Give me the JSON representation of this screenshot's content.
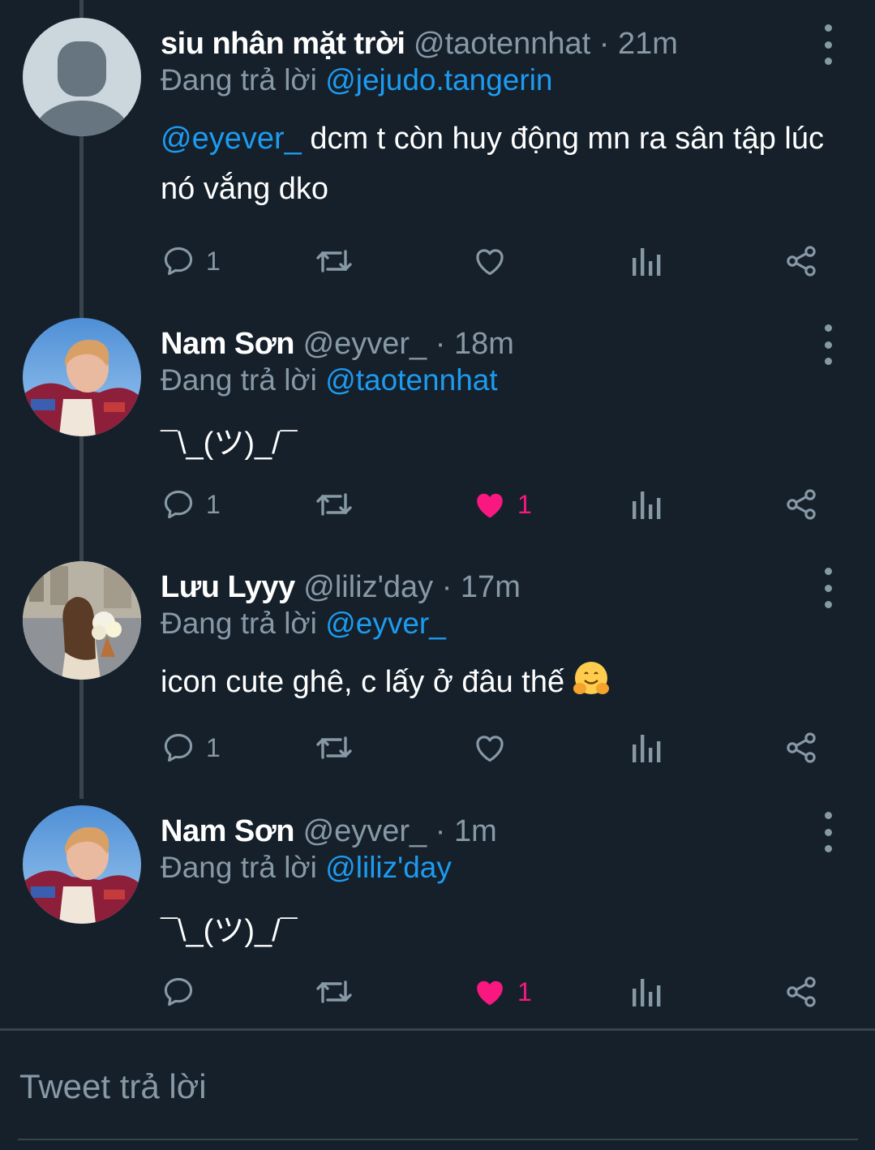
{
  "colors": {
    "background": "#15202b",
    "mention": "#1d9bf0",
    "muted": "#8899a6",
    "like": "#f91880",
    "separator": "#38444d"
  },
  "tweets": [
    {
      "name": "siu nhân mặt trời",
      "handle": "@taotennhat",
      "time": "21m",
      "reply_prefix": "Đang trả lời",
      "reply_to": "@jejudo.tangerin",
      "mention": "@eyever_",
      "text": " dcm t còn huy động mn ra sân tập lúc nó vắng dko",
      "reply_count": "1",
      "like_count": "",
      "liked": false,
      "avatar": "default-avatar"
    },
    {
      "name": "Nam Sơn",
      "handle": "@eyver_",
      "time": "18m",
      "reply_prefix": "Đang trả lời",
      "reply_to": "@taotennhat",
      "mention": "",
      "text": "¯\\_(ツ)_/¯",
      "reply_count": "1",
      "like_count": "1",
      "liked": true,
      "avatar": "boy-photo-avatar"
    },
    {
      "name": "Lưu Lyyy",
      "handle": "@liliz'day",
      "time": "17m",
      "reply_prefix": "Đang trả lời",
      "reply_to": "@eyver_",
      "mention": "",
      "text": "icon cute ghê, c lấy ở đâu thế",
      "emoji": "🤗",
      "reply_count": "1",
      "like_count": "",
      "liked": false,
      "avatar": "girl-street-avatar"
    },
    {
      "name": "Nam Sơn",
      "handle": "@eyver_",
      "time": "1m",
      "reply_prefix": "Đang trả lời",
      "reply_to": "@liliz'day",
      "mention": "",
      "text": "¯\\_(ツ)_/¯",
      "reply_count": "",
      "like_count": "1",
      "liked": true,
      "avatar": "boy-photo-avatar"
    }
  ],
  "separator_dot": "·",
  "compose": {
    "placeholder": "Tweet trả lời"
  }
}
